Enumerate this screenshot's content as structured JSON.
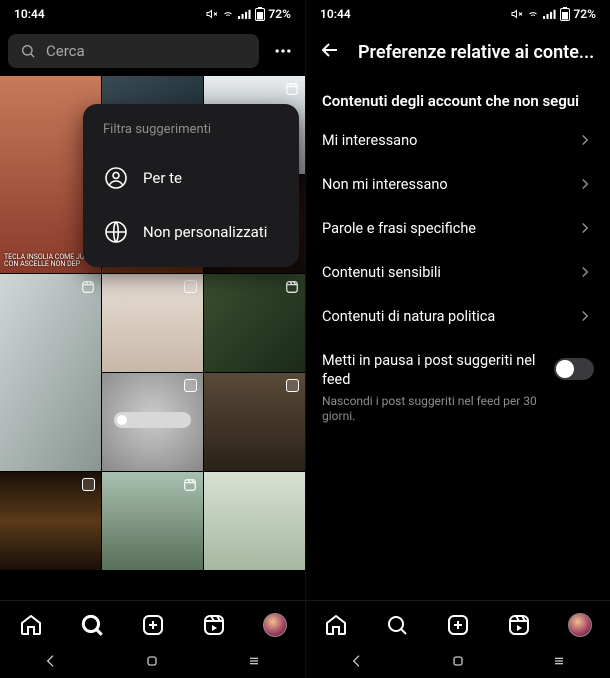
{
  "status": {
    "time": "10:44",
    "battery": "72%"
  },
  "left": {
    "search_placeholder": "Cerca",
    "dropdown": {
      "title": "Filtra suggerimenti",
      "item_for_you": "Per te",
      "item_not_personalized": "Non personalizzati"
    },
    "tiles": {
      "t1_caption": "TECLA INSOLIA COME JULIA CON ASCELLE NON DEP"
    }
  },
  "right": {
    "page_title": "Preferenze relative ai conte...",
    "section_title": "Contenuti degli account che non segui",
    "rows": {
      "interested": "Mi interessano",
      "not_interested": "Non mi interessano",
      "words": "Parole e frasi specifiche",
      "sensitive": "Contenuti sensibili",
      "political": "Contenuti di natura politica"
    },
    "toggle": {
      "title": "Metti in pausa i post suggeriti nel feed",
      "subtitle": "Nascondi i post suggeriti nel feed per 30 giorni."
    }
  }
}
